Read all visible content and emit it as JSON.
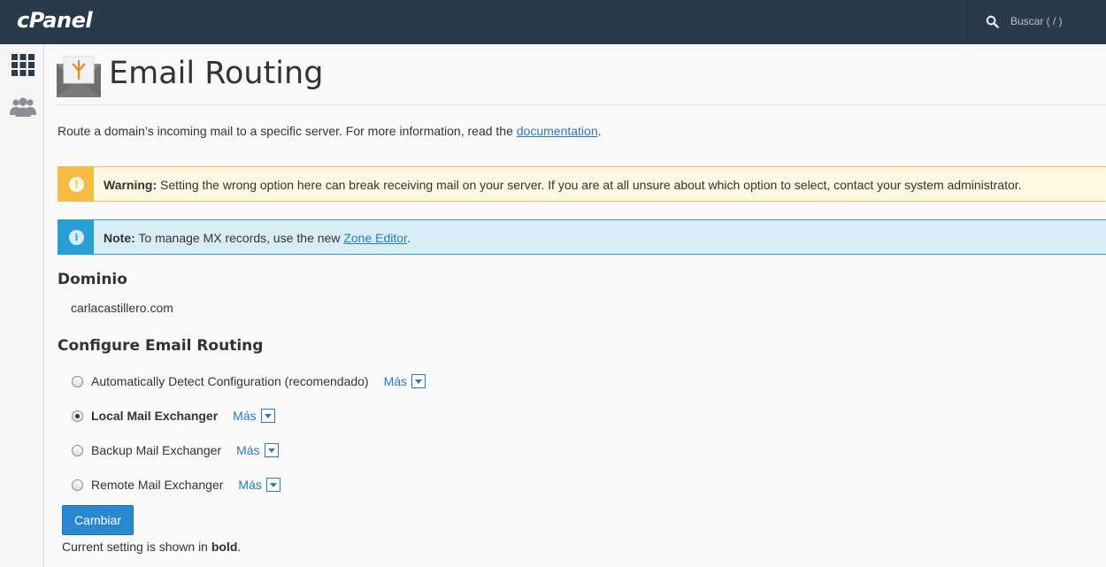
{
  "header": {
    "logo": "cPanel",
    "search_placeholder": "Buscar ( / )"
  },
  "sidebar": {
    "items": [
      {
        "icon": "grid-icon"
      },
      {
        "icon": "users-icon"
      }
    ]
  },
  "page": {
    "title": "Email Routing",
    "description_prefix": "Route a domain’s incoming mail to a specific server. For more information, read the ",
    "description_link": "documentation",
    "description_suffix": "."
  },
  "alerts": {
    "warning": {
      "label": "Warning:",
      "text": " Setting the wrong option here can break receiving mail on your server. If you are at all unsure about which option to select, contact your system administrator.",
      "icon": "!"
    },
    "note": {
      "label": "Note:",
      "text_prefix": " To manage MX records, use the new ",
      "link": "Zone Editor",
      "text_suffix": ".",
      "icon": "i"
    }
  },
  "domain": {
    "heading": "Dominio",
    "value": "carlacastillero.com"
  },
  "routing": {
    "heading": "Configure Email Routing",
    "more_label": "Más",
    "options": [
      {
        "label": "Automatically Detect Configuration (recomendado)",
        "checked": false
      },
      {
        "label": "Local Mail Exchanger",
        "checked": true
      },
      {
        "label": "Backup Mail Exchanger",
        "checked": false
      },
      {
        "label": "Remote Mail Exchanger",
        "checked": false
      }
    ],
    "submit_label": "Cambiar",
    "footnote_prefix": "Current setting is shown in ",
    "footnote_bold": "bold",
    "footnote_suffix": "."
  },
  "colors": {
    "topbar": "#293a4a",
    "warning": "#f6bb42",
    "info": "#2a9fd6",
    "link": "#2a7ab8",
    "button": "#2a88d0"
  }
}
